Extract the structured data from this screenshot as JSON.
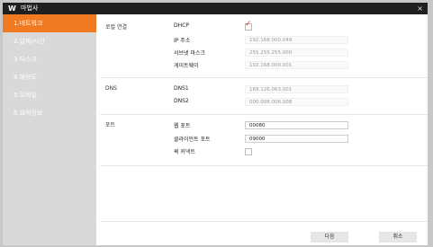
{
  "titlebar": {
    "logo": "W",
    "title": "마법사",
    "close": "×"
  },
  "sidebar": {
    "items": [
      {
        "label": "1.네트워크"
      },
      {
        "label": "2.날짜/시간"
      },
      {
        "label": "3.디스크"
      },
      {
        "label": "4.해상도"
      },
      {
        "label": "5.모바일"
      },
      {
        "label": "6.요약정보"
      }
    ]
  },
  "sections": {
    "local": {
      "title": "로컬 연결",
      "dhcp_label": "DHCP",
      "dhcp_checked": true,
      "ip_label": "IP 주소",
      "ip": "192.168.000.049",
      "subnet_label": "서브넷 마스크",
      "subnet": "255.255.255.000",
      "gateway_label": "게이트웨이",
      "gateway": "192.168.000.001"
    },
    "dns": {
      "title": "DNS",
      "dns1_label": "DNS1",
      "dns1": "168.126.063.001",
      "dns2_label": "DNS2",
      "dns2": "000.008.008.008"
    },
    "port": {
      "title": "포트",
      "web_label": "웹 포트",
      "web": "00080",
      "client_label": "클라이언트 포트",
      "client": "09000",
      "quick_label": "퀵 커넥트",
      "quick_checked": false
    }
  },
  "buttons": {
    "next": "다음",
    "cancel": "취소"
  },
  "colors": {
    "accent": "#f07a22",
    "check": "#e33333"
  }
}
